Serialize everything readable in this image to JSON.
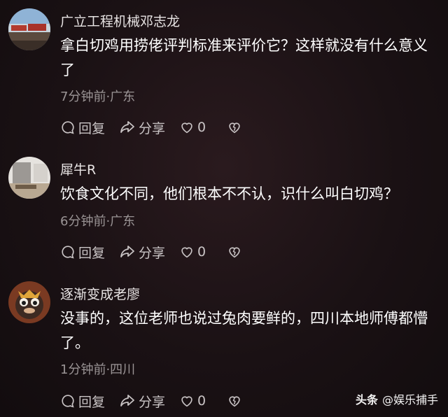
{
  "comments": [
    {
      "username": "广立工程机械邓志龙",
      "text": "拿白切鸡用捞佬评判标准来评价它？这样就没有什么意义了",
      "meta": "7分钟前·广东",
      "reply_label": "回复",
      "share_label": "分享",
      "like_count": "0"
    },
    {
      "username": "犀牛R",
      "text": "饮食文化不同，他们根本不不认，识什么叫白切鸡？",
      "meta": "6分钟前·广东",
      "reply_label": "回复",
      "share_label": "分享",
      "like_count": "0"
    },
    {
      "username": "逐渐变成老廖",
      "text": "没事的，这位老师也说过兔肉要鲜的，四川本地师傅都懵了。",
      "meta": "1分钟前·四川",
      "reply_label": "回复",
      "share_label": "分享",
      "like_count": "0"
    }
  ],
  "watermark": {
    "brand": "头条",
    "account": "@娱乐捕手"
  },
  "colors": {
    "background": "#1a1214",
    "text_primary": "#ffffff",
    "text_secondary": "#9a9495",
    "icon": "#c9c4c5"
  }
}
